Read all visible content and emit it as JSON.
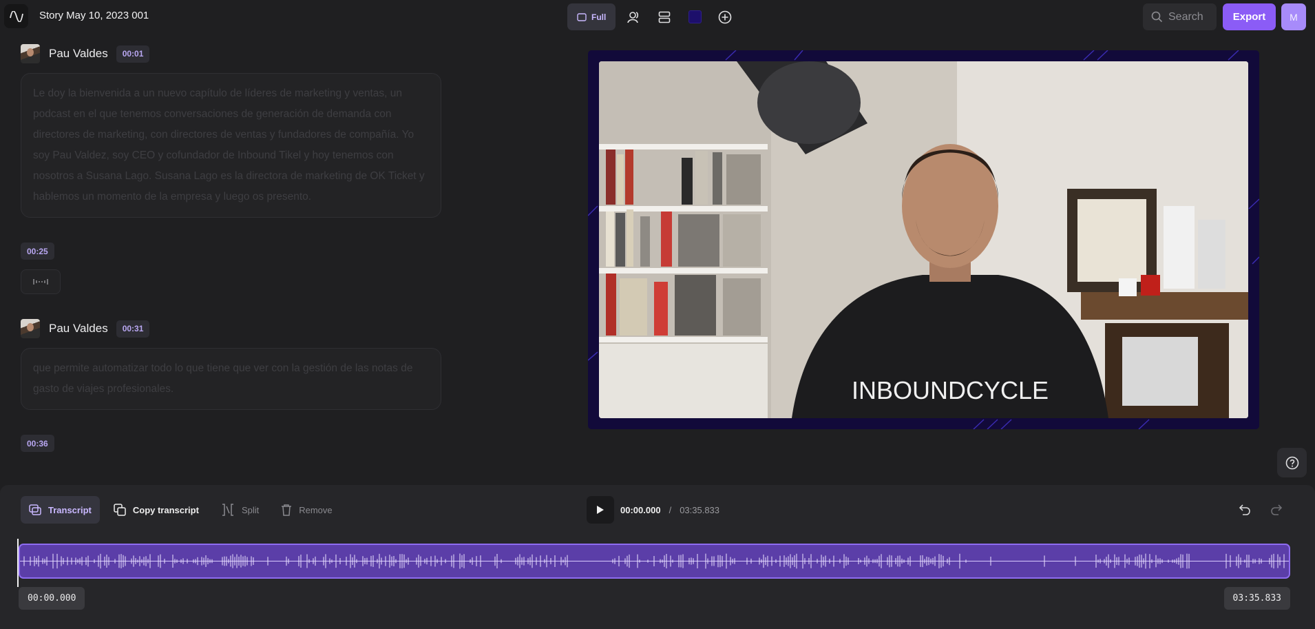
{
  "app": {
    "title": "Story May 10, 2023 001",
    "logo_icon": "waveform-logo-icon"
  },
  "toolbar": {
    "view_label": "Full",
    "icons": [
      "layout-icon",
      "speakers-icon",
      "scenes-icon",
      "brand-color-icon",
      "add-icon"
    ],
    "search_placeholder": "Search",
    "export_label": "Export",
    "avatar_initial": "M",
    "accent": "#8b5cf6"
  },
  "transcript": {
    "blocks": [
      {
        "speaker": "Pau Valdes",
        "time": "00:01",
        "text": "Le doy la bienvenida a un nuevo capítulo de líderes de marketing y ventas, un podcast en el que tenemos conversaciones de generación de demanda con directores de marketing, con directores de ventas y fundadores de compañía. Yo soy Pau Valdez, soy CEO y cofundador de Inbound Tikel y hoy tenemos con nosotros a Susana Lago. Susana Lago es la directora de marketing de OK Ticket y hablemos un momento de la empresa y luego os presento."
      },
      {
        "gap_time": "00:25",
        "gap_icon": "silence-waveform-icon"
      },
      {
        "speaker": "Pau Valdes",
        "time": "00:31",
        "text": "que permite automatizar todo lo que tiene que ver con la gestión de las notas de gasto de viajes profesionales."
      },
      {
        "gap_time": "00:36"
      }
    ]
  },
  "video": {
    "frame_color": "#120a3a",
    "shirt_text": "INBOUNDCYCLE"
  },
  "controls": {
    "transcript_label": "Transcript",
    "copy_label": "Copy transcript",
    "split_label": "Split",
    "remove_label": "Remove",
    "current_time": "00:00.000",
    "separator": "/",
    "total_time": "03:35.833",
    "timeline_start": "00:00.000",
    "timeline_end": "03:35.833"
  }
}
